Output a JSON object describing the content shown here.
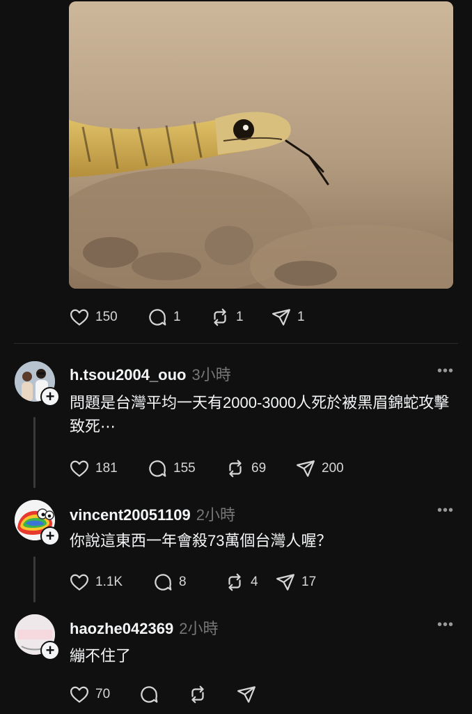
{
  "post": {
    "image": {
      "subject": "snake"
    },
    "actions": {
      "likes": "150",
      "comments": "1",
      "reposts": "1",
      "shares": "1"
    }
  },
  "replies": [
    {
      "username": "h.tsou2004_ouo",
      "time": "3小時",
      "text": "問題是台灣平均一天有2000-3000人死於被黑眉錦蛇攻擊致死⋯",
      "likes": "181",
      "comments": "155",
      "reposts": "69",
      "shares": "200"
    },
    {
      "username": "vincent20051109",
      "time": "2小時",
      "text": "你說這東西一年會殺73萬個台灣人喔？",
      "likes": "1.1K",
      "comments": "8",
      "reposts": "4",
      "shares": "17"
    },
    {
      "username": "haozhe042369",
      "time": "2小時",
      "text": "繃不住了",
      "likes": "70",
      "comments": "",
      "reposts": "",
      "shares": ""
    }
  ],
  "more_icon": "•••"
}
